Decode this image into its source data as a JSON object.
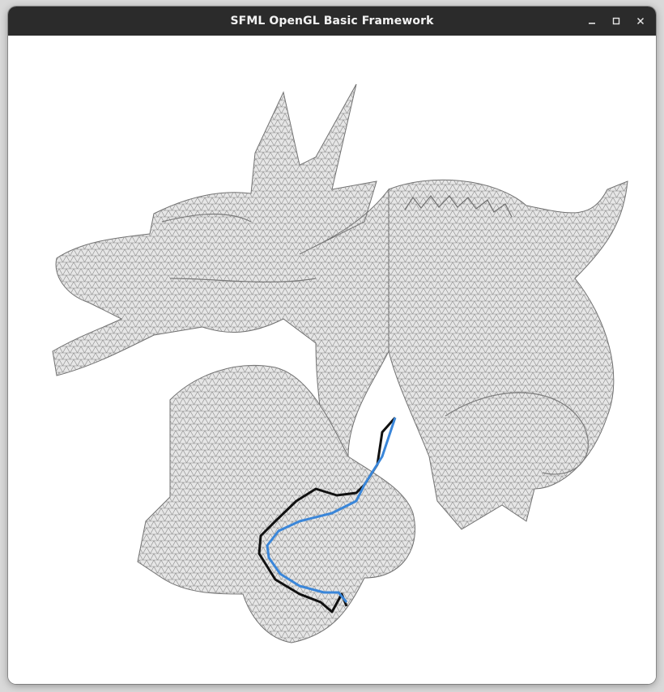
{
  "window": {
    "title": "SFML OpenGL Basic Framework",
    "controls": {
      "minimize": "minimize-icon",
      "maximize": "maximize-icon",
      "close": "close-icon"
    }
  },
  "scene": {
    "background": "#ffffff",
    "mesh": {
      "subject": "dragon",
      "fill_color": "#e6e6e6",
      "wire_color": "#8a8a8a"
    },
    "paths": [
      {
        "name": "black",
        "color": "#111111"
      },
      {
        "name": "blue",
        "color": "#3a86d9"
      }
    ]
  }
}
